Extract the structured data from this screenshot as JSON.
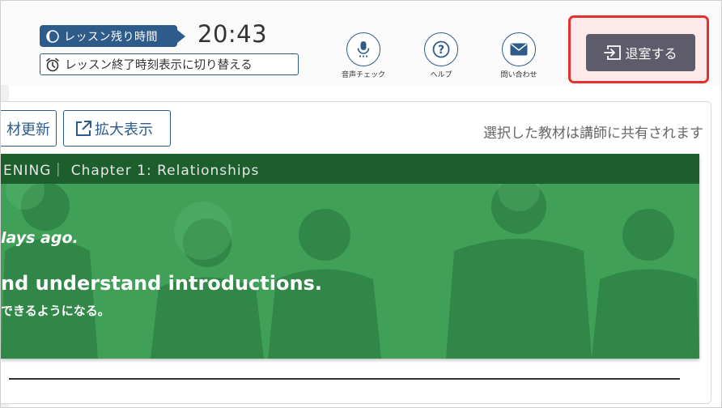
{
  "header": {
    "remaining_label": "レッスン残り時間",
    "remaining_time": "20:43",
    "switch_label": "レッスン終了時刻表示に切り替える",
    "tools": [
      {
        "icon": "microphone-icon",
        "label": "音声チェック"
      },
      {
        "icon": "help-icon",
        "label": "ヘルプ"
      },
      {
        "icon": "mail-icon",
        "label": "問い合わせ"
      }
    ],
    "exit_label": "退室する"
  },
  "material": {
    "update_label": "材更新",
    "expand_label": "拡大表示",
    "shared_notice": "選択した教材は講師に共有されます"
  },
  "banner": {
    "bar_title": "ENING｜ Chapter 1: Relationships",
    "line1": "lays ago.",
    "line2": "nd understand introductions.",
    "line3": "できるようになる。"
  },
  "colors": {
    "navy": "#2e5c8a",
    "banner_green": "#3a9a52",
    "bar_green": "#1c5e2c",
    "exit_button": "#5e5c6a",
    "highlight": "#e53030"
  }
}
